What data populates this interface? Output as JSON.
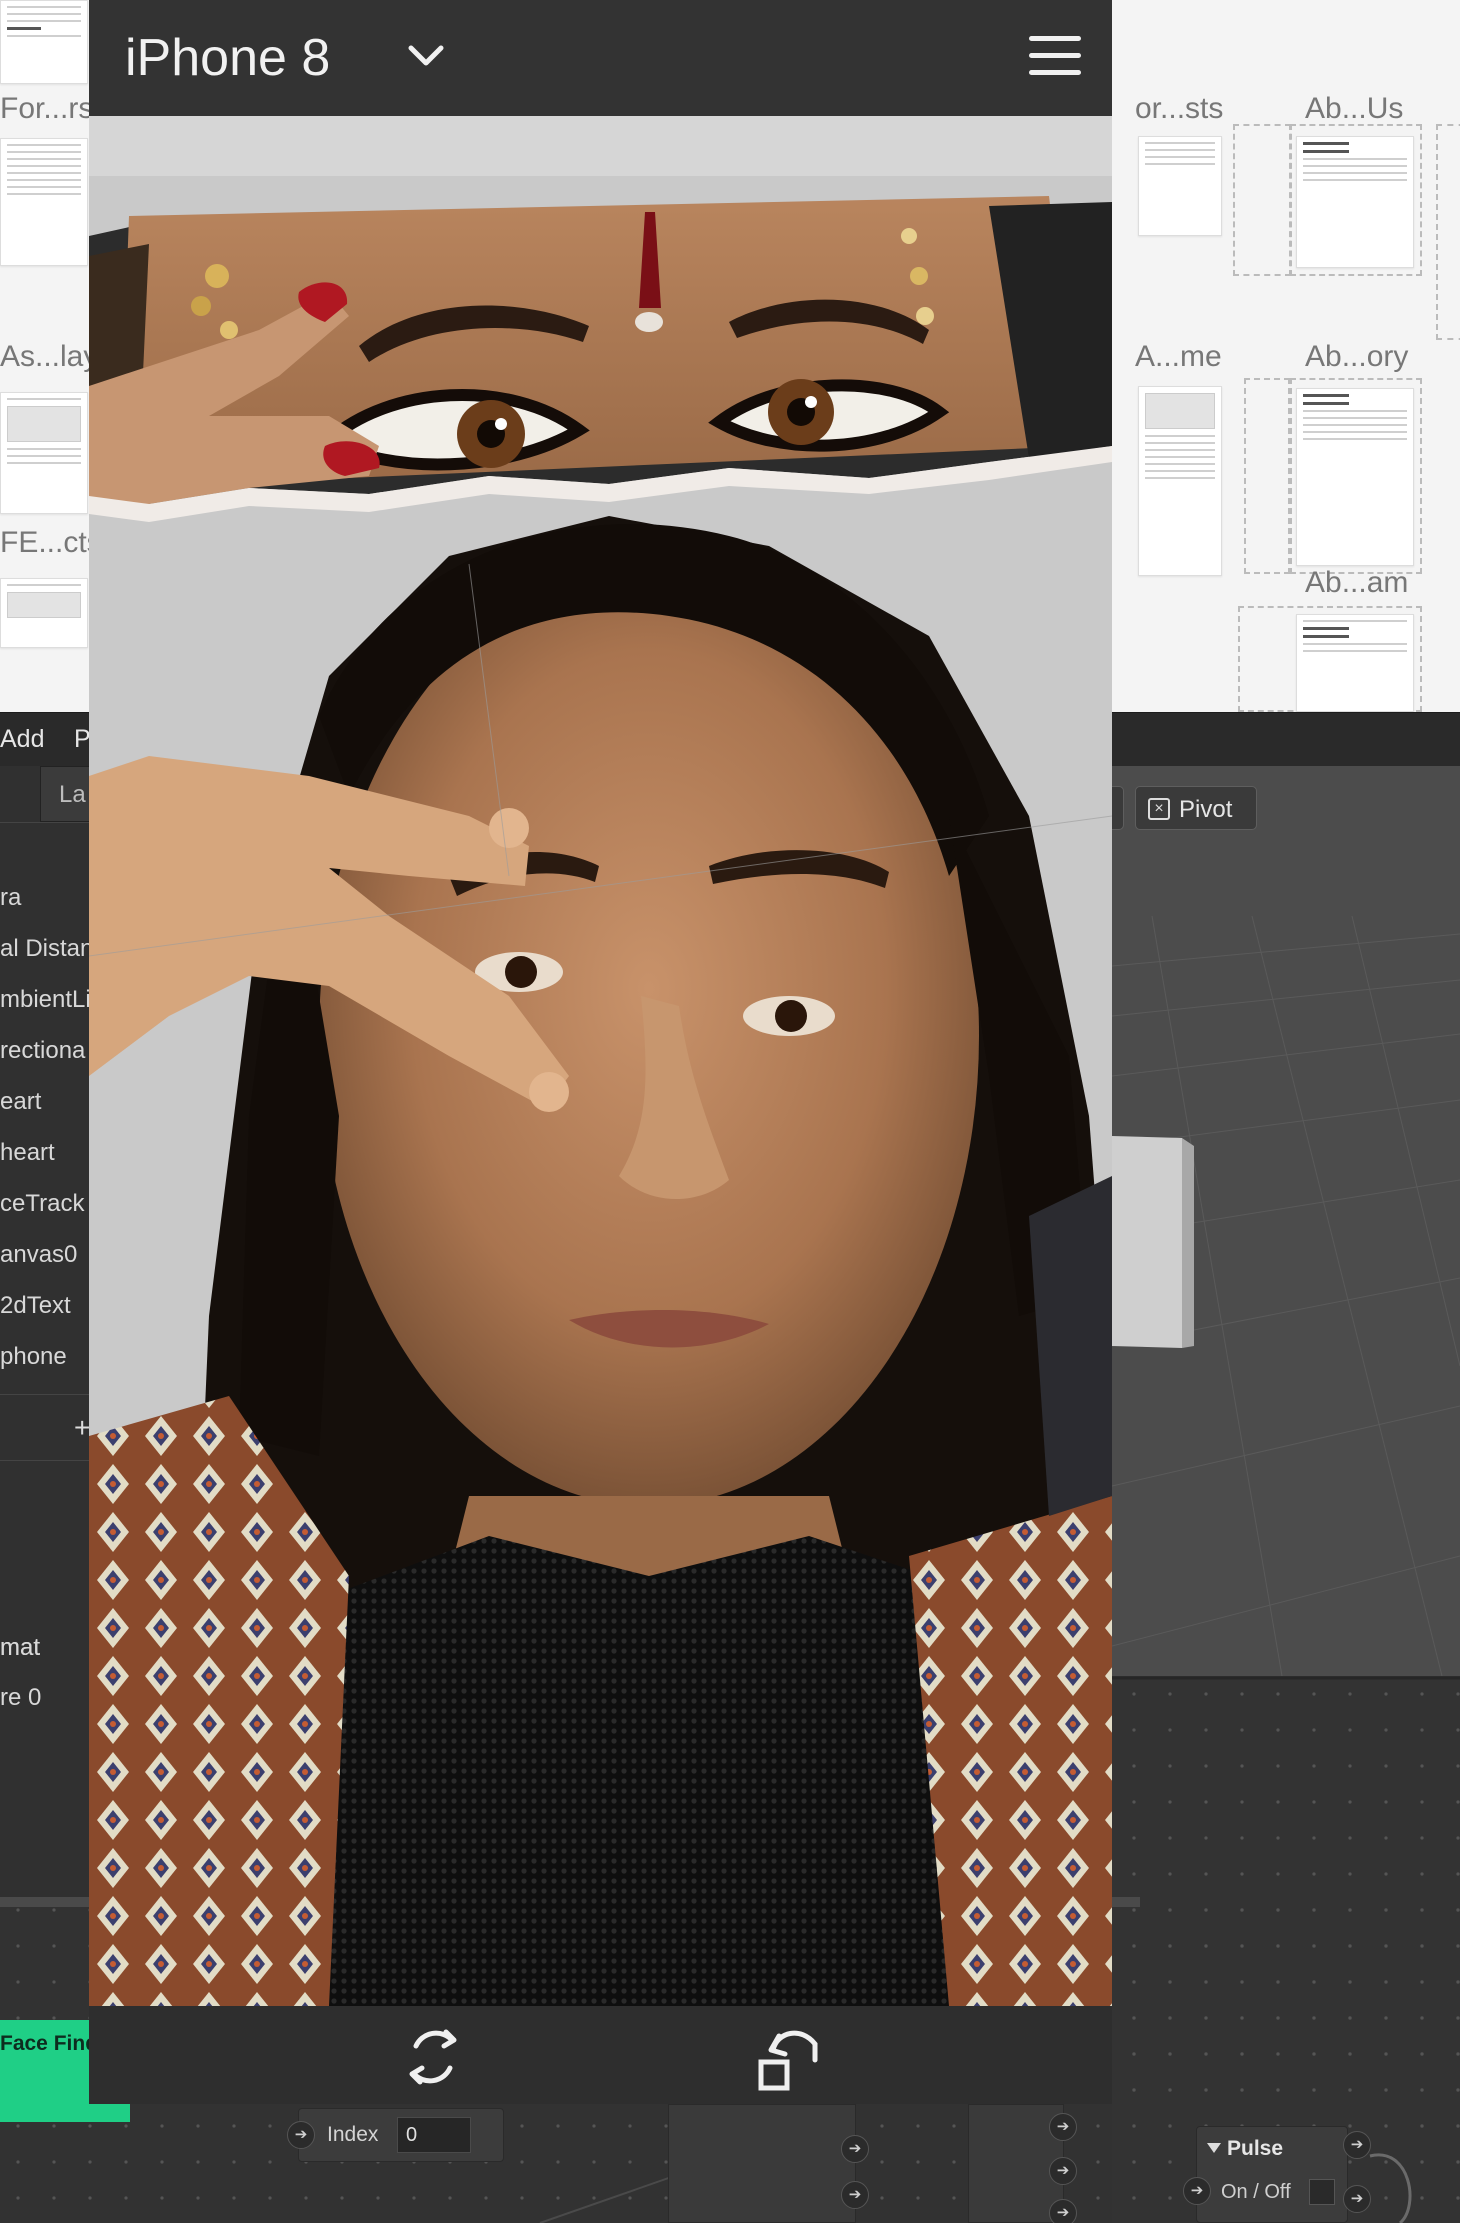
{
  "artboards": {
    "labels": [
      "For...rs",
      "As...lay",
      "FE...cts",
      "or...sts",
      "Ab...Us",
      "A...me",
      "Ab...ory",
      "Ab...am"
    ]
  },
  "editor": {
    "menu": [
      "Add",
      "P"
    ],
    "layers_tab": "La",
    "scene_items": [
      "ra",
      "al Distan",
      "mbientLi",
      "rectiona",
      "eart",
      " heart",
      "ceTrack",
      "anvas0",
      " 2dText",
      "phone"
    ],
    "add_symbol": "+",
    "asset_items": [
      "mat",
      "re 0"
    ],
    "pivot_label": "Pivot",
    "pivot_icon": "close-square-icon"
  },
  "patches": {
    "face_finder": "Face Finde",
    "index_node": {
      "label": "Index",
      "value": "0"
    },
    "pulse_node": {
      "title": "Pulse",
      "port_label": "On / Off"
    },
    "accent_color": "#1fcf86"
  },
  "phone": {
    "device": "iPhone 8",
    "device_menu_icon": "chevron-down-icon",
    "menu_icon": "hamburger-menu-icon",
    "toolbar": {
      "flip_icon": "flip-camera-icon",
      "rotate_icon": "rotate-device-icon"
    }
  }
}
